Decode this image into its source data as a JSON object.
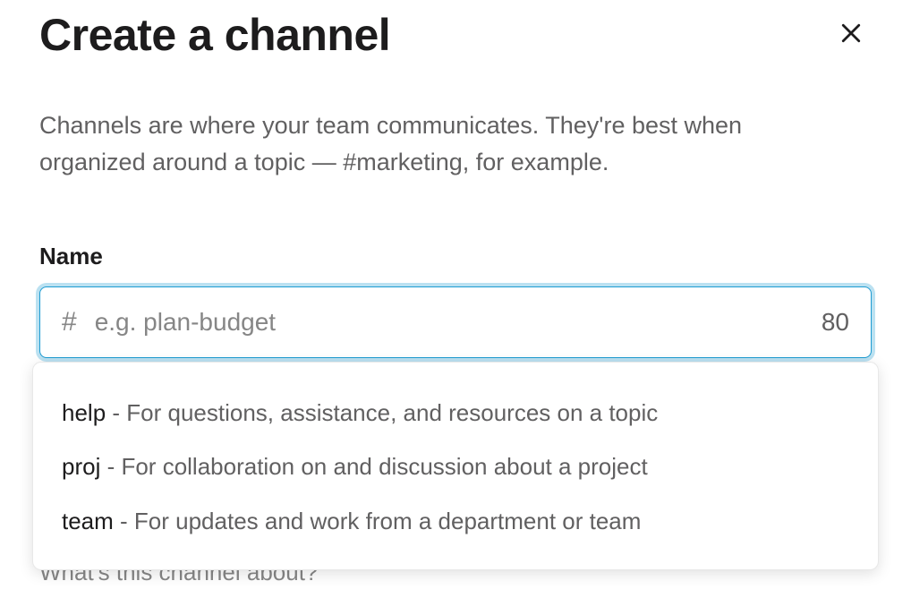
{
  "modal": {
    "title": "Create a channel",
    "description": "Channels are where your team communicates. They're best when organized around a topic — #marketing, for example."
  },
  "name_field": {
    "label": "Name",
    "hash": "#",
    "placeholder": "e.g. plan-budget",
    "value": "",
    "char_remaining": "80"
  },
  "suggestions": [
    {
      "prefix": "help",
      "desc": " - For questions, assistance, and resources on a topic"
    },
    {
      "prefix": "proj",
      "desc": " - For collaboration on and discussion about a project"
    },
    {
      "prefix": "team",
      "desc": " - For updates and work from a department or team"
    }
  ],
  "below_input_text": "What's this channel about?"
}
